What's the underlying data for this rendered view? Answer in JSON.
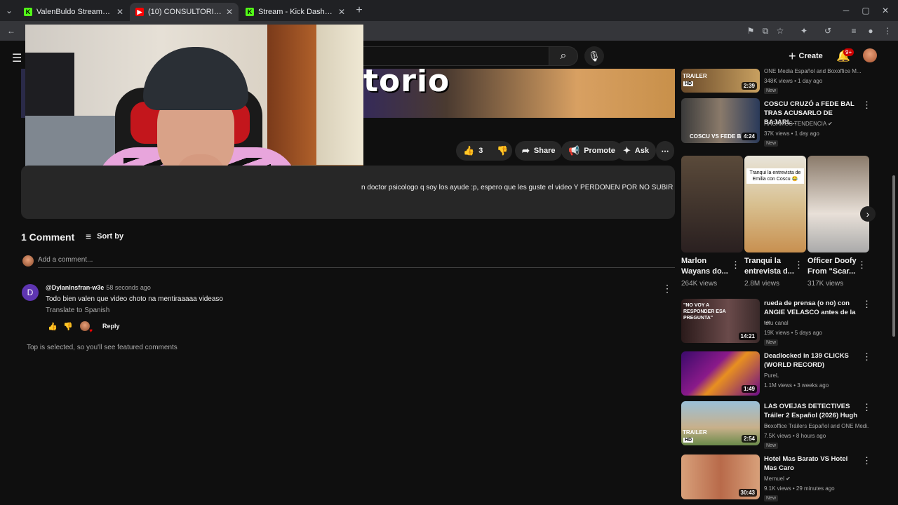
{
  "tabs": [
    {
      "title": "ValenBuldo Stream - Watch Live",
      "favicon": "kick-icon"
    },
    {
      "title": "(10) CONSULTORIO CON SEGUI",
      "favicon": "youtube-icon"
    },
    {
      "title": "Stream - Kick Dashboard",
      "favicon": "kick-icon"
    }
  ],
  "header": {
    "create_label": "Create",
    "notification_badge": "9+"
  },
  "video": {
    "banner_text": "torio",
    "description": "n doctor psicologo q soy los ayude :p, espero que les guste el video Y PERDONEN POR NO SUBIR"
  },
  "actions": {
    "likes": "3",
    "share": "Share",
    "promote": "Promote",
    "ask": "Ask"
  },
  "comments": {
    "count_label": "1 Comment",
    "sort_label": "Sort by",
    "add_placeholder": "Add a comment...",
    "items": [
      {
        "avatar_letter": "D",
        "author": "@DylanInsfran-w3e",
        "time": "58 seconds ago",
        "text": "Todo bien valen que video choto na mentiraaaaa videaso",
        "translate": "Translate to Spanish",
        "reply": "Reply"
      }
    ],
    "featured_note": "Top is selected, so you'll see featured comments"
  },
  "recommendations": [
    {
      "duration": "2:39",
      "title": "",
      "channel": "ONE Media Español and Boxoffice M...",
      "meta": "348K views • 1 day ago",
      "badge": "New"
    },
    {
      "duration": "4:24",
      "title": "COSCU CRUZÓ a FEDE BAL TRAS ACUSARLO DE BAJARL...",
      "channel": "HAGAMOS TENDENCIA",
      "meta": "37K views • 1 day ago",
      "badge": "New"
    },
    {
      "duration": "14:21",
      "title": "rueda de prensa (o no) con ANGIE VELASCO antes de la ...",
      "channel": "tdtu canal",
      "meta": "19K views • 5 days ago",
      "badge": "New"
    },
    {
      "duration": "1:49",
      "title": "Deadlocked in 139 CLICKS (WORLD RECORD)",
      "channel": "PureL",
      "meta": "1.1M views • 3 weeks ago",
      "badge": ""
    },
    {
      "duration": "2:54",
      "title": "LAS OVEJAS DETECTIVES Tráiler 2 Español (2026) Hugh ...",
      "channel": "Boxoffice Tráilers Español and ONE Medi...",
      "meta": "7.5K views • 8 hours ago",
      "badge": "New"
    },
    {
      "duration": "30:43",
      "title": "Hotel Mas Barato VS Hotel Mas Caro",
      "channel": "Mernuel",
      "meta": "9.1K views • 29 minutes ago",
      "badge": "New"
    }
  ],
  "shorts": [
    {
      "title": "Marlon Wayans do...",
      "views": "264K views",
      "overlay": ""
    },
    {
      "title": "Tranqui la entrevista d...",
      "views": "2.8M views",
      "overlay": "Tranqui la entrevista de Emilia con Coscu 😂"
    },
    {
      "title": "Officer Doofy From \"Scar...",
      "views": "317K views",
      "overlay": ""
    }
  ],
  "thumb_text": {
    "trailer": "TRAILER",
    "hd": "HD",
    "coscu": "COSCU VS FEDE B",
    "novoy": "\"NO VOY A RESPONDER ESA PREGUNTA\""
  }
}
